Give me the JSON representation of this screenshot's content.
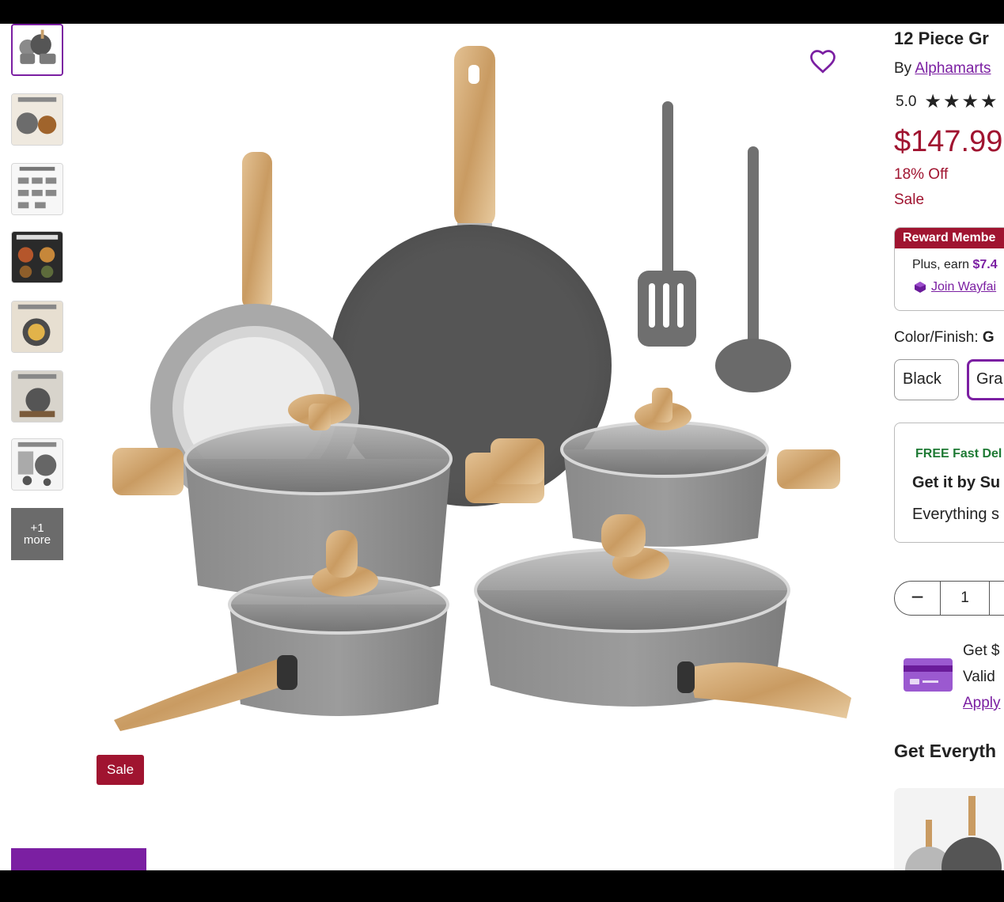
{
  "gallery": {
    "more_line1": "+1",
    "more_line2": "more",
    "sale_badge": "Sale"
  },
  "product": {
    "title": "12 Piece Gr",
    "by_prefix": "By ",
    "brand": "Alphamarts",
    "rating": "5.0",
    "stars": "★★★★",
    "price": "$147.99",
    "discount": "18% Off",
    "sale": "Sale"
  },
  "reward": {
    "heading": "Reward Membe",
    "earn_prefix": "Plus, earn ",
    "earn_amount": "$7.4",
    "join_link": "Join Wayfai"
  },
  "color": {
    "label": "Color/Finish: ",
    "selected": "G",
    "options": [
      "Black",
      "Gra"
    ]
  },
  "delivery": {
    "free": "FREE Fast Del",
    "get_it": "Get it by Su",
    "everything": "Everything s"
  },
  "quantity": {
    "minus": "−",
    "value": "1"
  },
  "promo": {
    "line1": "Get $",
    "line2": "Valid",
    "apply": "Apply"
  },
  "section": {
    "get_everything": "Get Everyth"
  },
  "colors": {
    "brand_purple": "#7b1fa2",
    "sale_red": "#a01430",
    "free_green": "#1e7a34"
  }
}
